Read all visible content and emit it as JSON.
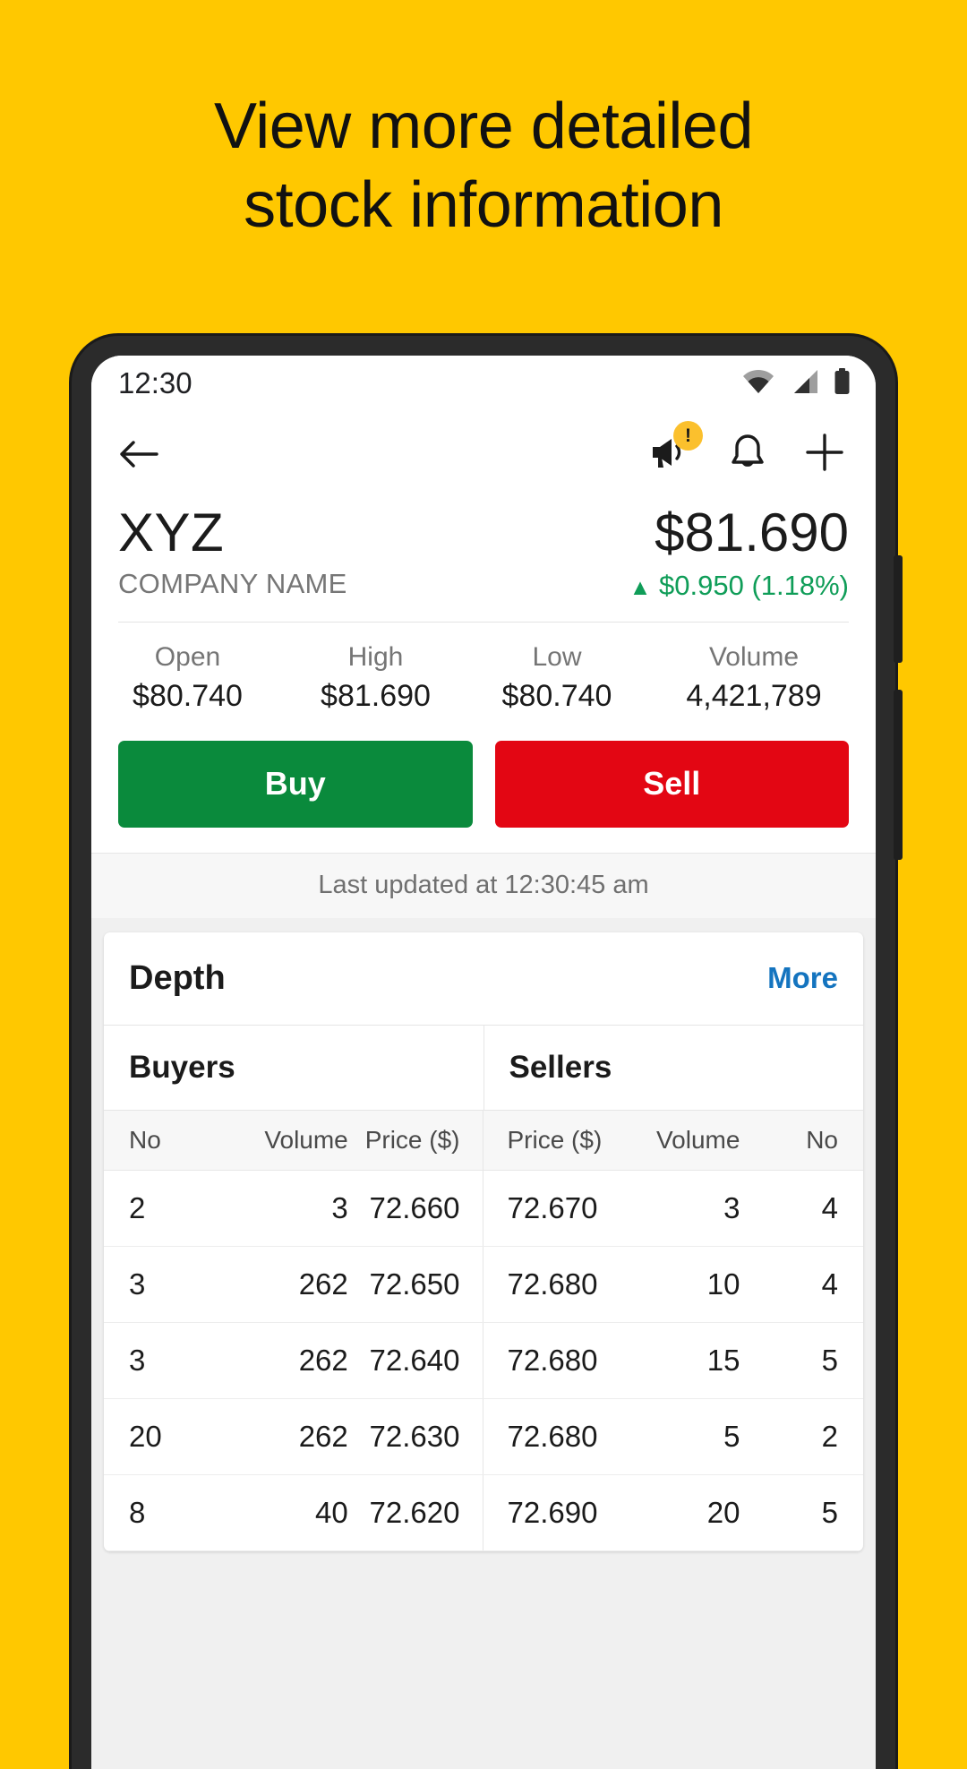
{
  "promo": {
    "line1": "View more detailed",
    "line2": "stock information",
    "background_color": "#FFC800"
  },
  "statusbar": {
    "time": "12:30",
    "icons": [
      "wifi-icon",
      "cellular-icon",
      "battery-icon"
    ]
  },
  "navbar": {
    "back_icon": "back-arrow-icon",
    "announcement_icon": "megaphone-icon",
    "announcement_badge": "!",
    "alerts_icon": "bell-icon",
    "add_icon": "plus-icon"
  },
  "quote": {
    "symbol": "XYZ",
    "company": "COMPANY NAME",
    "price": "$81.690",
    "change_arrow": "▲",
    "change_value": "$0.950",
    "change_percent": "(1.18%)",
    "change_color": "#0F9D58"
  },
  "stats": [
    {
      "label": "Open",
      "value": "$80.740"
    },
    {
      "label": "High",
      "value": "$81.690"
    },
    {
      "label": "Low",
      "value": "$80.740"
    },
    {
      "label": "Volume",
      "value": "4,421,789"
    },
    {
      "label": "",
      "value": "$"
    }
  ],
  "actions": {
    "buy_label": "Buy",
    "buy_color": "#0A8A3C",
    "sell_label": "Sell",
    "sell_color": "#E30613"
  },
  "updated": "Last updated at 12:30:45 am",
  "depth": {
    "title": "Depth",
    "more_label": "More",
    "more_color": "#1474BF",
    "buyers_label": "Buyers",
    "sellers_label": "Sellers",
    "columns": [
      "No",
      "Volume",
      "Price ($)",
      "Price ($)",
      "Volume",
      "No"
    ],
    "rows": [
      {
        "buy_no": "2",
        "buy_vol": "3",
        "buy_price": "72.660",
        "sell_price": "72.670",
        "sell_vol": "3",
        "sell_no": "4"
      },
      {
        "buy_no": "3",
        "buy_vol": "262",
        "buy_price": "72.650",
        "sell_price": "72.680",
        "sell_vol": "10",
        "sell_no": "4"
      },
      {
        "buy_no": "3",
        "buy_vol": "262",
        "buy_price": "72.640",
        "sell_price": "72.680",
        "sell_vol": "15",
        "sell_no": "5"
      },
      {
        "buy_no": "20",
        "buy_vol": "262",
        "buy_price": "72.630",
        "sell_price": "72.680",
        "sell_vol": "5",
        "sell_no": "2"
      },
      {
        "buy_no": "8",
        "buy_vol": "40",
        "buy_price": "72.620",
        "sell_price": "72.690",
        "sell_vol": "20",
        "sell_no": "5"
      }
    ]
  }
}
